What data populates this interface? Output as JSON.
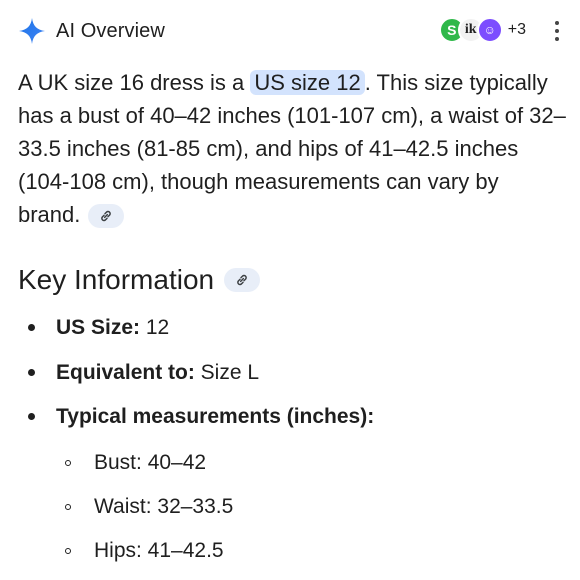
{
  "header": {
    "title": "AI Overview",
    "source_icons": [
      "S",
      "ik",
      "☺"
    ],
    "more_sources": "+3"
  },
  "summary": {
    "before": "A UK size 16 dress is a ",
    "highlight": "US size 12",
    "after": ". This size typically has a bust of 40–42 inches (101-107 cm), a waist of 32–33.5 inches (81-85 cm), and hips of 41–42.5 inches (104-108 cm), though measurements can vary by brand."
  },
  "key_info": {
    "heading": "Key Information",
    "items": [
      {
        "label": "US Size:",
        "value": " 12"
      },
      {
        "label": "Equivalent to:",
        "value": " Size L"
      },
      {
        "label": "Typical measurements (inches):",
        "value": ""
      }
    ],
    "measurements": [
      "Bust: 40–42",
      "Waist: 32–33.5",
      "Hips: 41–42.5"
    ]
  },
  "colors": {
    "highlight_bg": "#d3e3fd",
    "link_chip_bg": "#e8eef8",
    "gemini_blue": "#4285f4",
    "text": "#1f1f1f"
  },
  "icons": {
    "header_left": "gemini-spark-icon",
    "link": "link-icon",
    "menu": "more-vert-icon"
  }
}
